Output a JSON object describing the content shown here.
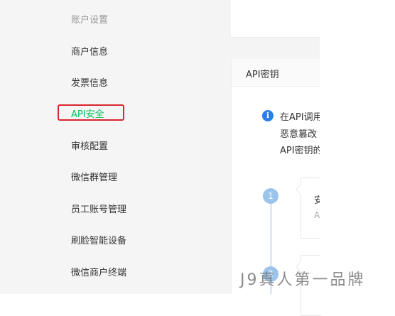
{
  "sidebar": {
    "section_title": "账户设置",
    "items": [
      {
        "label": "商户信息",
        "active": false
      },
      {
        "label": "发票信息",
        "active": false
      },
      {
        "label": "API安全",
        "active": true
      },
      {
        "label": "审核配置",
        "active": false
      },
      {
        "label": "微信群管理",
        "active": false
      },
      {
        "label": "员工账号管理",
        "active": false
      },
      {
        "label": "刷脸智能设备",
        "active": false
      },
      {
        "label": "微信商户终端",
        "active": false
      }
    ]
  },
  "panel": {
    "title": "API密钥",
    "notice_icon": "info-icon",
    "notice_lines": [
      "在API调用",
      "恶意篡改",
      "API密钥的"
    ],
    "steps": [
      {
        "number": "1",
        "title": "安",
        "desc": "A"
      },
      {
        "number": "2"
      }
    ]
  },
  "watermark": "J9真人第一品牌",
  "colors": {
    "active": "#07c160",
    "highlight_box": "#d9262c",
    "info_icon": "#2b7de9",
    "step_circle": "#9cc3ea"
  }
}
